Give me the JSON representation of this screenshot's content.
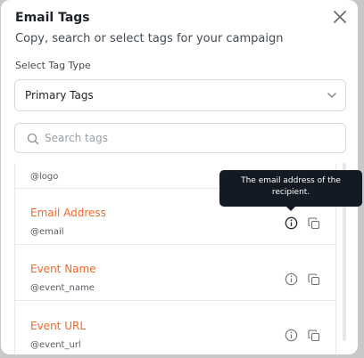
{
  "modal": {
    "title": "Email Tags",
    "subtitle": "Copy, search or select tags for your campaign",
    "tag_type_label": "Select Tag Type",
    "tag_type_value": "Primary Tags",
    "search_placeholder": "Search tags"
  },
  "tags": [
    {
      "name": "",
      "tag": "@logo"
    },
    {
      "name": "Email Address",
      "tag": "@email"
    },
    {
      "name": "Event Name",
      "tag": "@event_name"
    },
    {
      "name": "Event URL",
      "tag": "@event_url"
    }
  ],
  "tooltip": {
    "text": "The email address of the recipient."
  },
  "colors": {
    "accent": "#f06a2a",
    "tooltip_bg": "#141a24",
    "backdrop": "#c8c8c8"
  },
  "icons": [
    "close-icon",
    "chevron-down-icon",
    "search-icon",
    "info-icon",
    "copy-icon"
  ]
}
